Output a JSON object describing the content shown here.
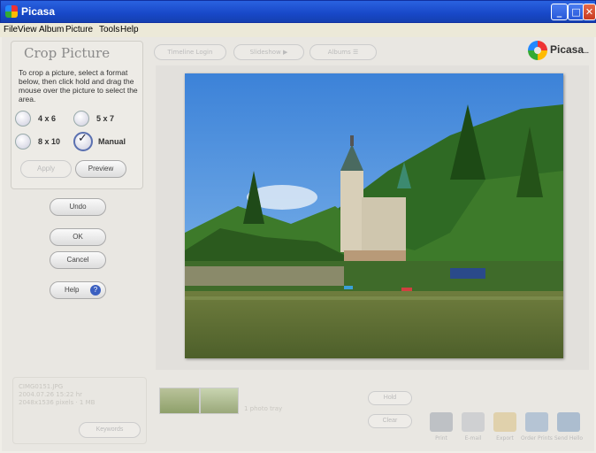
{
  "window": {
    "title": "Picasa",
    "buttons": [
      "_",
      "□",
      "✕"
    ]
  },
  "menu": [
    "File",
    "View",
    "Album",
    "Picture",
    "Tools",
    "Help"
  ],
  "toolbar": {
    "brand": "Picasa",
    "brand_suffix": "...",
    "buttons": [
      {
        "label": "Timeline",
        "badge": "Login"
      },
      {
        "label": "Slideshow",
        "badge": "▶"
      },
      {
        "label": "Albums",
        "badge": "☰"
      }
    ]
  },
  "crop": {
    "title": "Crop Picture",
    "help": "To crop a picture, select a format below, then click hold and drag the mouse over the picture to select the area.",
    "options": [
      {
        "label": "4 x 6",
        "checked": false
      },
      {
        "label": "5 x 7",
        "checked": false
      },
      {
        "label": "8 x 10",
        "checked": false
      },
      {
        "label": "Manual",
        "checked": true
      }
    ],
    "apply_label": "Apply",
    "preview_label": "Preview"
  },
  "actions": {
    "undo": "Undo",
    "ok": "OK",
    "cancel": "Cancel",
    "help": "Help"
  },
  "info": {
    "filename": "CIMG0151.JPG",
    "date": "2004.07.26 15:22 hr",
    "size": "2048x1536 pixels · 1 MB",
    "keywords_label": "Keywords"
  },
  "tray": {
    "label": "1 photo tray",
    "hold": "Hold",
    "clear": "Clear"
  },
  "tools": [
    "Print",
    "E-mail",
    "Export",
    "Order Prints",
    "Send Hello"
  ],
  "colors": {
    "titlebar": "#1848c8",
    "accent": "#5a70b0"
  }
}
